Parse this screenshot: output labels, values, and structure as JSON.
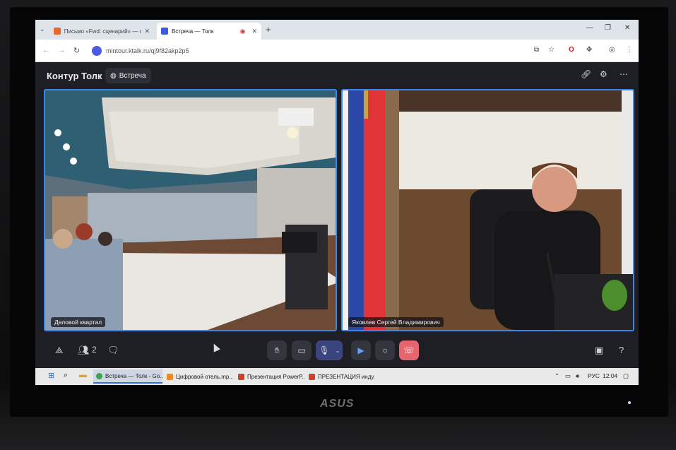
{
  "browser": {
    "tabs": [
      {
        "label": "Письмо «Fwd: сценарий» — d",
        "active": false
      },
      {
        "label": "Встреча — Толк",
        "active": true
      }
    ],
    "url": "mintour.ktalk.ru/qj9f82akp2p5"
  },
  "app": {
    "brand": "Контур Толк",
    "meeting_label": "Встреча",
    "participants_count": "2",
    "videos": [
      {
        "label": "Деловой квартал"
      },
      {
        "label": "Яковлев Сергей Владимирович"
      }
    ]
  },
  "taskbar": {
    "tasks": [
      {
        "label": "Встреча — Толк - Go...",
        "active": true
      },
      {
        "label": "Цифровой отель.mp...",
        "active": false
      },
      {
        "label": "Презентация PowerP...",
        "active": false
      },
      {
        "label": "ПРЕЗЕНТАЦИЯ инду...",
        "active": false
      }
    ],
    "lang": "РУС",
    "time": "12:04"
  },
  "monitor": {
    "brand": "ASUS"
  },
  "colors": {
    "accent": "#3d86e8",
    "hangup": "#e7656f",
    "app_bg": "#1e1f24"
  }
}
